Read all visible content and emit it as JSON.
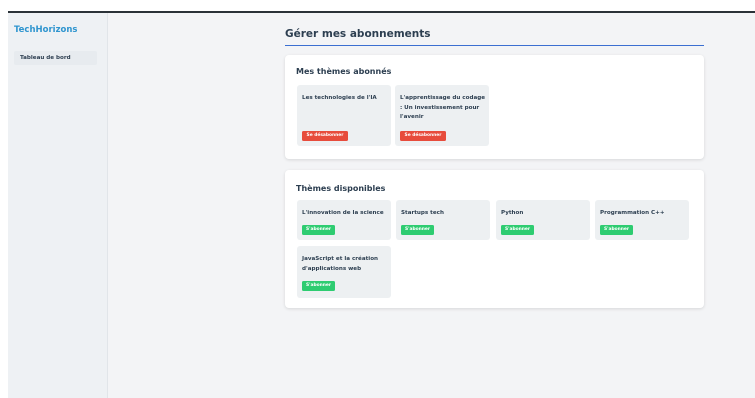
{
  "sidebar": {
    "brand": "TechHorizons",
    "items": [
      {
        "label": "Tableau de bord"
      }
    ]
  },
  "main": {
    "title": "Gérer mes abonnements",
    "subscribed": {
      "title": "Mes thèmes abonnés",
      "themes": [
        {
          "name": "Les technologies de l'IA",
          "button": "Se désabonner"
        },
        {
          "name": "L'apprentissage du codage : Un investissement pour l'avenir",
          "button": "Se désabonner"
        }
      ]
    },
    "available": {
      "title": "Thèmes disponibles",
      "themes": [
        {
          "name": "L'innovation de la science",
          "button": "S'abonner"
        },
        {
          "name": "Startups tech",
          "button": "S'abonner"
        },
        {
          "name": "Python",
          "button": "S'abonner"
        },
        {
          "name": "Programmation C++",
          "button": "S'abonner"
        },
        {
          "name": "JavaScript et la création d'applications web",
          "button": "S'abonner"
        }
      ]
    }
  },
  "colors": {
    "brand": "#2f95cf",
    "unsubscribe": "#e74c3c",
    "subscribe": "#2ecc71",
    "title_rule": "#3b6fd1"
  }
}
